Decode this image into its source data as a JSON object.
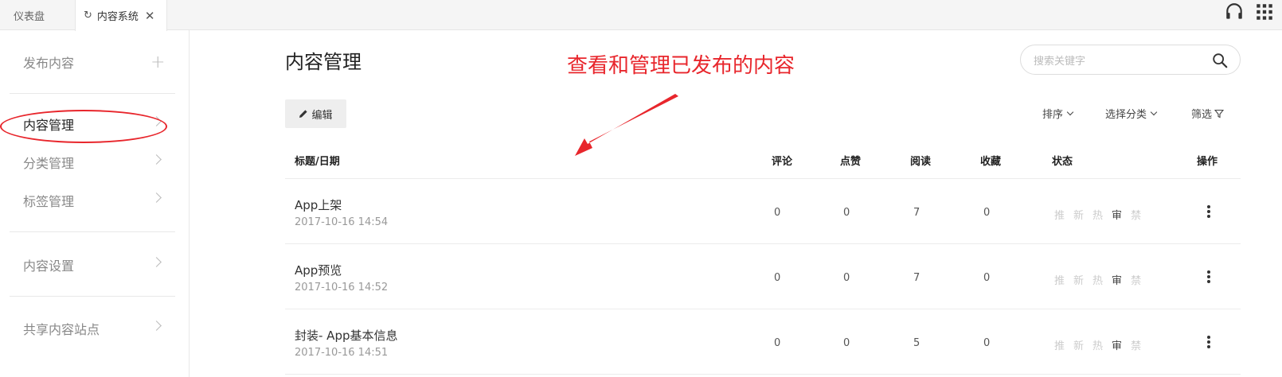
{
  "tabs": [
    {
      "label": "仪表盘"
    },
    {
      "label": "内容系统"
    }
  ],
  "sidebar": {
    "items": [
      {
        "label": "发布内容"
      },
      {
        "label": "内容管理"
      },
      {
        "label": "分类管理"
      },
      {
        "label": "标签管理"
      },
      {
        "label": "内容设置"
      },
      {
        "label": "共享内容站点"
      }
    ]
  },
  "main": {
    "title": "内容管理",
    "annotation": "查看和管理已发布的内容",
    "search": {
      "placeholder": "搜索关键字",
      "value": ""
    },
    "edit_label": "编辑",
    "filters": {
      "sort": "排序",
      "category": "选择分类",
      "filter": "筛选"
    },
    "columns": {
      "title": "标题/日期",
      "comments": "评论",
      "likes": "点赞",
      "reads": "阅读",
      "favorites": "收藏",
      "status": "状态",
      "actions": "操作"
    },
    "status_labels": [
      "推",
      "新",
      "热",
      "审",
      "禁"
    ],
    "rows": [
      {
        "title": "App上架",
        "date": "2017-10-16 14:54",
        "comments": "0",
        "likes": "0",
        "reads": "7",
        "favorites": "0"
      },
      {
        "title": "App预览",
        "date": "2017-10-16 14:52",
        "comments": "0",
        "likes": "0",
        "reads": "7",
        "favorites": "0"
      },
      {
        "title": "封装- App基本信息",
        "date": "2017-10-16 14:51",
        "comments": "0",
        "likes": "0",
        "reads": "5",
        "favorites": "0"
      }
    ]
  },
  "colors": {
    "annotation": "#e8262c",
    "active_status": "#444444",
    "inactive_status": "#cccccc"
  }
}
